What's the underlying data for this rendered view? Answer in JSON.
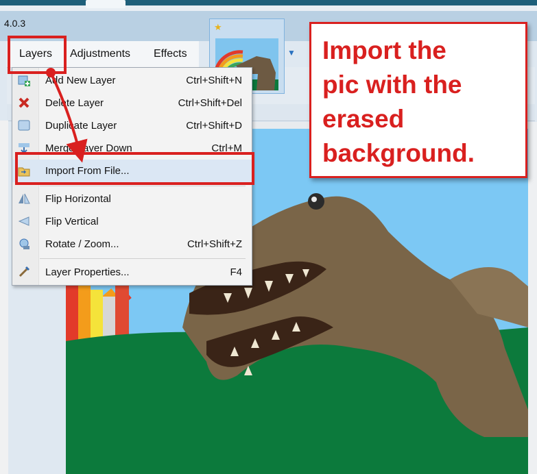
{
  "window": {
    "version": "4.0.3"
  },
  "menubar": {
    "items": [
      {
        "label": "Layers"
      },
      {
        "label": "Adjustments"
      },
      {
        "label": "Effects"
      }
    ]
  },
  "layers_menu": {
    "items": [
      {
        "label": "Add New Layer",
        "shortcut": "Ctrl+Shift+N",
        "icon": "add-layer-icon"
      },
      {
        "label": "Delete Layer",
        "shortcut": "Ctrl+Shift+Del",
        "icon": "delete-x-icon"
      },
      {
        "label": "Duplicate Layer",
        "shortcut": "Ctrl+Shift+D",
        "icon": "duplicate-layer-icon"
      },
      {
        "label": "Merge Layer Down",
        "shortcut": "Ctrl+M",
        "icon": "merge-down-icon"
      },
      {
        "label": "Import From File...",
        "shortcut": "",
        "icon": "import-folder-icon",
        "highlighted": true
      },
      {
        "label": "Flip Horizontal",
        "shortcut": "",
        "icon": "flip-horizontal-icon"
      },
      {
        "label": "Flip Vertical",
        "shortcut": "",
        "icon": "flip-vertical-icon"
      },
      {
        "label": "Rotate / Zoom...",
        "shortcut": "Ctrl+Shift+Z",
        "icon": "rotate-zoom-icon"
      },
      {
        "label": "Layer Properties...",
        "shortcut": "F4",
        "icon": "layer-properties-icon"
      }
    ]
  },
  "annotation": {
    "text": "Import the\npic with the\nerased\nbackground.",
    "color": "#d9201f"
  },
  "colors": {
    "accent_red": "#d9201f",
    "sky": "#7cc8f4",
    "grass": "#0c7a3c"
  }
}
